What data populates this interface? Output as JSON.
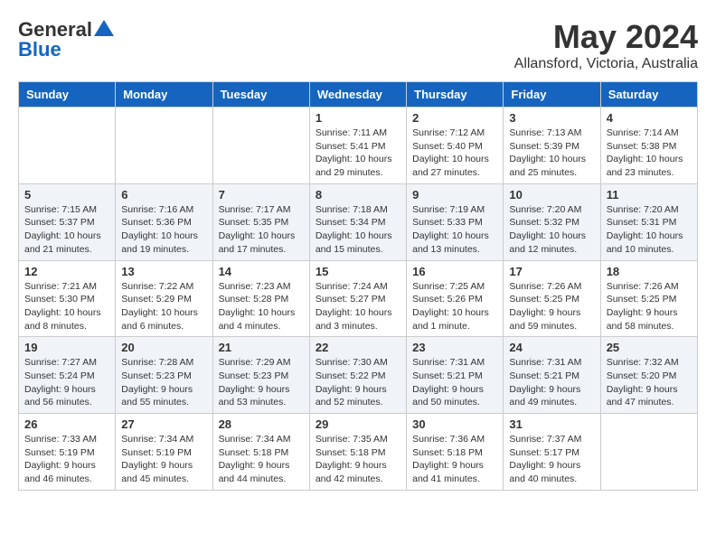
{
  "header": {
    "logo_general": "General",
    "logo_blue": "Blue",
    "month": "May 2024",
    "location": "Allansford, Victoria, Australia"
  },
  "weekdays": [
    "Sunday",
    "Monday",
    "Tuesday",
    "Wednesday",
    "Thursday",
    "Friday",
    "Saturday"
  ],
  "weeks": [
    [
      {
        "day": "",
        "info": ""
      },
      {
        "day": "",
        "info": ""
      },
      {
        "day": "",
        "info": ""
      },
      {
        "day": "1",
        "info": "Sunrise: 7:11 AM\nSunset: 5:41 PM\nDaylight: 10 hours\nand 29 minutes."
      },
      {
        "day": "2",
        "info": "Sunrise: 7:12 AM\nSunset: 5:40 PM\nDaylight: 10 hours\nand 27 minutes."
      },
      {
        "day": "3",
        "info": "Sunrise: 7:13 AM\nSunset: 5:39 PM\nDaylight: 10 hours\nand 25 minutes."
      },
      {
        "day": "4",
        "info": "Sunrise: 7:14 AM\nSunset: 5:38 PM\nDaylight: 10 hours\nand 23 minutes."
      }
    ],
    [
      {
        "day": "5",
        "info": "Sunrise: 7:15 AM\nSunset: 5:37 PM\nDaylight: 10 hours\nand 21 minutes."
      },
      {
        "day": "6",
        "info": "Sunrise: 7:16 AM\nSunset: 5:36 PM\nDaylight: 10 hours\nand 19 minutes."
      },
      {
        "day": "7",
        "info": "Sunrise: 7:17 AM\nSunset: 5:35 PM\nDaylight: 10 hours\nand 17 minutes."
      },
      {
        "day": "8",
        "info": "Sunrise: 7:18 AM\nSunset: 5:34 PM\nDaylight: 10 hours\nand 15 minutes."
      },
      {
        "day": "9",
        "info": "Sunrise: 7:19 AM\nSunset: 5:33 PM\nDaylight: 10 hours\nand 13 minutes."
      },
      {
        "day": "10",
        "info": "Sunrise: 7:20 AM\nSunset: 5:32 PM\nDaylight: 10 hours\nand 12 minutes."
      },
      {
        "day": "11",
        "info": "Sunrise: 7:20 AM\nSunset: 5:31 PM\nDaylight: 10 hours\nand 10 minutes."
      }
    ],
    [
      {
        "day": "12",
        "info": "Sunrise: 7:21 AM\nSunset: 5:30 PM\nDaylight: 10 hours\nand 8 minutes."
      },
      {
        "day": "13",
        "info": "Sunrise: 7:22 AM\nSunset: 5:29 PM\nDaylight: 10 hours\nand 6 minutes."
      },
      {
        "day": "14",
        "info": "Sunrise: 7:23 AM\nSunset: 5:28 PM\nDaylight: 10 hours\nand 4 minutes."
      },
      {
        "day": "15",
        "info": "Sunrise: 7:24 AM\nSunset: 5:27 PM\nDaylight: 10 hours\nand 3 minutes."
      },
      {
        "day": "16",
        "info": "Sunrise: 7:25 AM\nSunset: 5:26 PM\nDaylight: 10 hours\nand 1 minute."
      },
      {
        "day": "17",
        "info": "Sunrise: 7:26 AM\nSunset: 5:25 PM\nDaylight: 9 hours\nand 59 minutes."
      },
      {
        "day": "18",
        "info": "Sunrise: 7:26 AM\nSunset: 5:25 PM\nDaylight: 9 hours\nand 58 minutes."
      }
    ],
    [
      {
        "day": "19",
        "info": "Sunrise: 7:27 AM\nSunset: 5:24 PM\nDaylight: 9 hours\nand 56 minutes."
      },
      {
        "day": "20",
        "info": "Sunrise: 7:28 AM\nSunset: 5:23 PM\nDaylight: 9 hours\nand 55 minutes."
      },
      {
        "day": "21",
        "info": "Sunrise: 7:29 AM\nSunset: 5:23 PM\nDaylight: 9 hours\nand 53 minutes."
      },
      {
        "day": "22",
        "info": "Sunrise: 7:30 AM\nSunset: 5:22 PM\nDaylight: 9 hours\nand 52 minutes."
      },
      {
        "day": "23",
        "info": "Sunrise: 7:31 AM\nSunset: 5:21 PM\nDaylight: 9 hours\nand 50 minutes."
      },
      {
        "day": "24",
        "info": "Sunrise: 7:31 AM\nSunset: 5:21 PM\nDaylight: 9 hours\nand 49 minutes."
      },
      {
        "day": "25",
        "info": "Sunrise: 7:32 AM\nSunset: 5:20 PM\nDaylight: 9 hours\nand 47 minutes."
      }
    ],
    [
      {
        "day": "26",
        "info": "Sunrise: 7:33 AM\nSunset: 5:19 PM\nDaylight: 9 hours\nand 46 minutes."
      },
      {
        "day": "27",
        "info": "Sunrise: 7:34 AM\nSunset: 5:19 PM\nDaylight: 9 hours\nand 45 minutes."
      },
      {
        "day": "28",
        "info": "Sunrise: 7:34 AM\nSunset: 5:18 PM\nDaylight: 9 hours\nand 44 minutes."
      },
      {
        "day": "29",
        "info": "Sunrise: 7:35 AM\nSunset: 5:18 PM\nDaylight: 9 hours\nand 42 minutes."
      },
      {
        "day": "30",
        "info": "Sunrise: 7:36 AM\nSunset: 5:18 PM\nDaylight: 9 hours\nand 41 minutes."
      },
      {
        "day": "31",
        "info": "Sunrise: 7:37 AM\nSunset: 5:17 PM\nDaylight: 9 hours\nand 40 minutes."
      },
      {
        "day": "",
        "info": ""
      }
    ]
  ]
}
